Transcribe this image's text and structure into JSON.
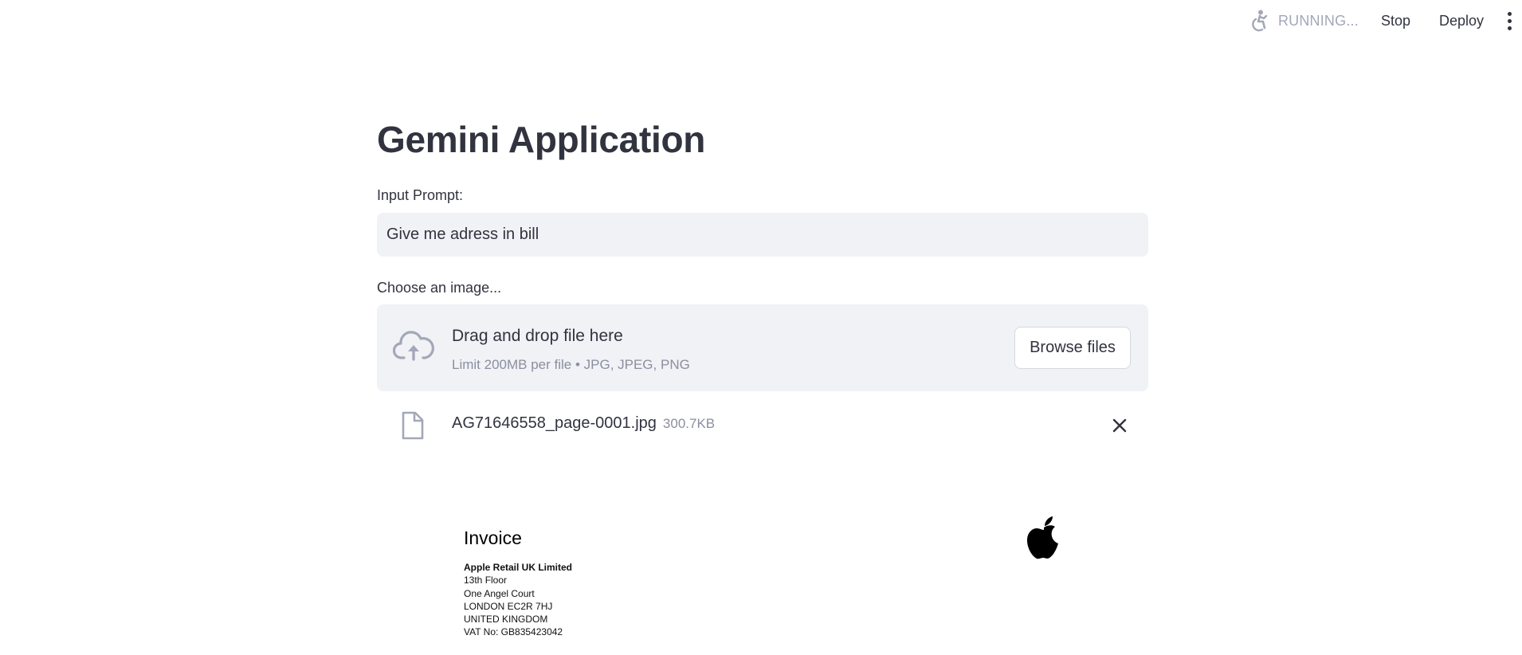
{
  "toolbar": {
    "status": "RUNNING...",
    "stop_label": "Stop",
    "deploy_label": "Deploy",
    "running_icon": "running-figure-icon",
    "menu_icon": "kebab-menu-icon"
  },
  "page": {
    "title": "Gemini Application"
  },
  "prompt": {
    "label": "Input Prompt:",
    "value": "Give me adress in bill"
  },
  "uploader": {
    "label": "Choose an image...",
    "drop_title": "Drag and drop file here",
    "drop_subtitle": "Limit 200MB per file • JPG, JPEG, PNG",
    "browse_label": "Browse files",
    "icon": "cloud-upload-icon"
  },
  "uploaded_file": {
    "name": "AG71646558_page-0001.jpg",
    "size": "300.7KB",
    "icon": "file-icon"
  },
  "invoice": {
    "title": "Invoice",
    "company": "Apple Retail UK Limited",
    "lines": [
      "13th Floor",
      "One Angel Court",
      "LONDON EC2R 7HJ",
      "UNITED KINGDOM",
      "VAT No: GB835423042"
    ],
    "logo": "apple-logo-icon"
  },
  "colors": {
    "text": "#31333f",
    "muted": "#8b8f9f",
    "input_bg": "#f0f2f6",
    "icon": "#a3a8b8"
  }
}
